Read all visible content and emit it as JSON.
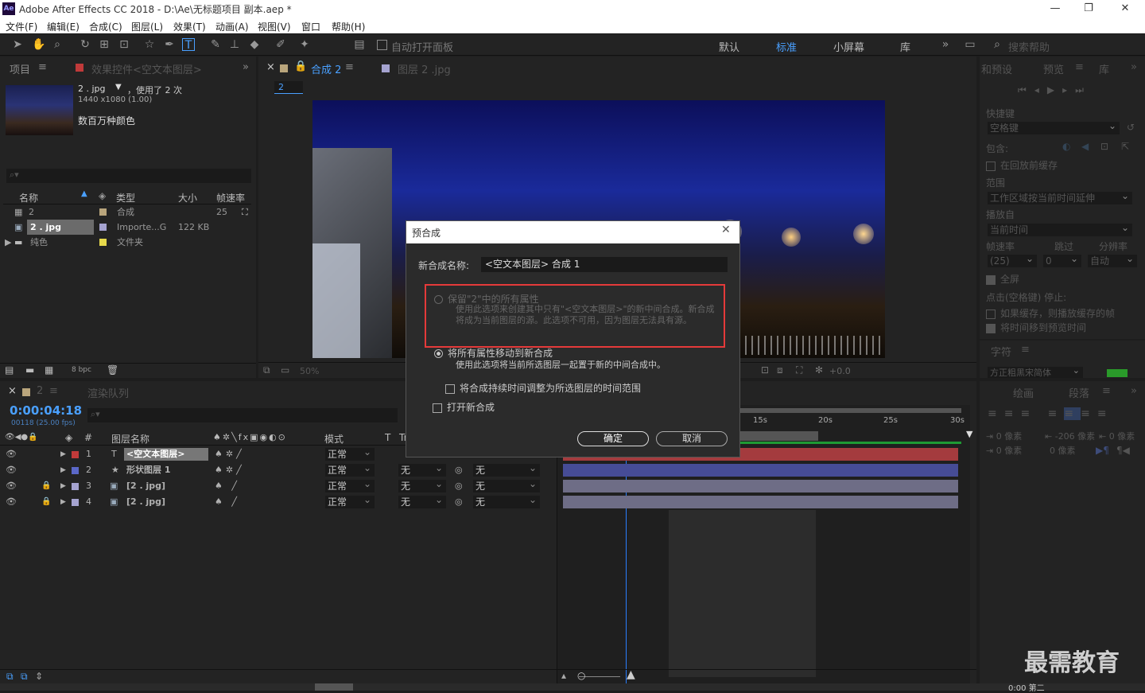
{
  "app": {
    "logo": "Ae",
    "title": "Adobe After Effects CC 2018 - D:\\Ae\\无标题项目 副本.aep *"
  },
  "menu": [
    "文件(F)",
    "编辑(E)",
    "合成(C)",
    "图层(L)",
    "效果(T)",
    "动画(A)",
    "视图(V)",
    "窗口",
    "帮助(H)"
  ],
  "toolbar": {
    "auto_open_label": "自动打开面板",
    "workspaces": [
      "默认",
      "标准",
      "小屏幕",
      "库"
    ],
    "search_placeholder": "搜索帮助"
  },
  "project_panel": {
    "tab_project": "项目",
    "tab_effects": "效果控件<空文本图层>",
    "selected_name": "2 . jpg",
    "used_text": "，使用了 2 次",
    "resolution": "1440 x1080 (1.00)",
    "color_text": "数百万种颜色",
    "columns": [
      "名称",
      "类型",
      "大小",
      "帧速率"
    ],
    "items": [
      {
        "name": "2",
        "type": "合成",
        "size": "",
        "fps": "25",
        "color": "#b9a57c"
      },
      {
        "name": "2 . jpg",
        "type": "Importe...G",
        "size": "122 KB",
        "fps": "",
        "color": "#a5a3d0"
      },
      {
        "name": "纯色",
        "type": "文件夹",
        "size": "",
        "fps": "",
        "color": "#e6d94b"
      }
    ],
    "bpc": "8 bpc"
  },
  "comp_panel": {
    "tab_comp": "合成 2",
    "tab_layer": "图层 2 .jpg",
    "comp_tab": "2",
    "zoom": "50%",
    "exposure": "+0.0"
  },
  "right_panel": {
    "tab_presets": "和预设",
    "tab_preview": "预览",
    "tab_library": "库",
    "shortcut_label": "快捷键",
    "shortcut_value": "空格键",
    "include_label": "包含:",
    "cache_label": "在回放前缓存",
    "range_label": "范围",
    "range_value": "工作区域按当前时间延伸",
    "play_from_label": "播放自",
    "play_from_value": "当前时间",
    "fps_label": "帧速率",
    "skip_label": "跳过",
    "res_label": "分辨率",
    "fps_value": "(25)",
    "skip_value": "0",
    "res_value": "自动",
    "fullscreen_label": "全屏",
    "stop_label": "点击(空格键) 停止:",
    "if_cached_label": "如果缓存，则播放缓存的帧",
    "move_time_label": "将时间移到预览时间",
    "char_label": "字符",
    "font_value": "方正粗黑宋简体",
    "tab_paint": "绘画",
    "tab_paragraph": "段落",
    "indent_left": "0 像素",
    "indent_right": "0 像素",
    "indent_first": "0 像素",
    "space_before": "-206 像素",
    "space_after": "0 像素"
  },
  "timeline": {
    "tab_comp": "2",
    "tab_render": "渲染队列",
    "timecode": "0:00:04:18",
    "frame_info": "00118 (25.00 fps)",
    "col_num": "#",
    "col_name": "图层名称",
    "col_mode": "模式",
    "col_t": "T",
    "col_trkmat": "Tr",
    "ruler": [
      "15s",
      "20s",
      "25s",
      "30s"
    ],
    "layers": [
      {
        "num": "1",
        "icon": "T",
        "name": "<空文本图层>",
        "mode": "正常",
        "trk": "",
        "parent": "",
        "color": "#c03a3a",
        "bar": "#a43b3e",
        "locked": false
      },
      {
        "num": "2",
        "icon": "★",
        "name": "形状图层 1",
        "mode": "正常",
        "trk": "无",
        "parent": "无",
        "color": "#5b68c8",
        "bar": "#464c96",
        "locked": false
      },
      {
        "num": "3",
        "icon": "▣",
        "name": "[2 . jpg]",
        "mode": "正常",
        "trk": "无",
        "parent": "无",
        "color": "#a5a3d0",
        "bar": "#6e6d86",
        "locked": true
      },
      {
        "num": "4",
        "icon": "▣",
        "name": "[2 . jpg]",
        "mode": "正常",
        "trk": "无",
        "parent": "无",
        "color": "#a5a3d0",
        "bar": "#6e6d86",
        "locked": true
      }
    ]
  },
  "dialog": {
    "title": "预合成",
    "name_label": "新合成名称:",
    "name_value": "<空文本图层> 合成 1",
    "option1_label": "保留\"2\"中的所有属性",
    "option1_desc": "使用此选项来创建其中只有\"<空文本图层>\"的新中间合成。新合成将成为当前图层的源。此选项不可用，因为图层无法具有源。",
    "option2_label": "将所有属性移动到新合成",
    "option2_desc": "使用此选项将当前所选图层一起置于新的中间合成中。",
    "adjust_label": "将合成持续时间调整为所选图层的时间范围",
    "open_label": "打开新合成",
    "ok_label": "确定",
    "cancel_label": "取消"
  },
  "watermark": "最需教育",
  "bottom_time": "0:00 第二"
}
